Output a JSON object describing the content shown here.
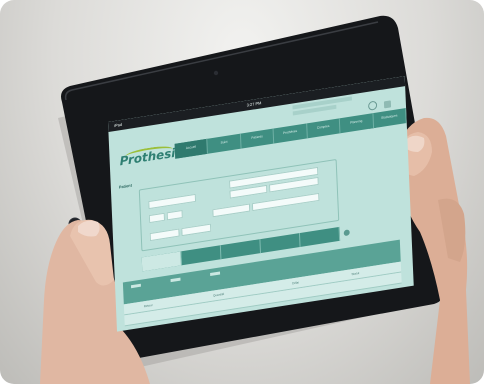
{
  "photo": {
    "description_icons": [
      "front-camera-icon",
      "home-button-icon"
    ],
    "colors": {
      "background": "#dcdbd8",
      "bezel": "#15171a",
      "screen": "#bfe2dc",
      "accent": "#3f8f82",
      "logo_green": "#9bbf3a"
    }
  },
  "app": {
    "logo_text": "Prothesis",
    "status_left": "iPad",
    "status_time": "3:27 PM",
    "nav_items": [
      "Accueil",
      "Suivi",
      "Patients",
      "Prothèses",
      "Comptes",
      "Planning",
      "Statistiques"
    ],
    "subtitle": "Patient",
    "header_columns": [
      "",
      "",
      "",
      "",
      "",
      "",
      ""
    ],
    "table_columns": [
      "Retour",
      "Quantité",
      "Délai",
      "Statut"
    ],
    "icons": [
      "refresh-icon",
      "settings-icon",
      "close-icon"
    ]
  }
}
